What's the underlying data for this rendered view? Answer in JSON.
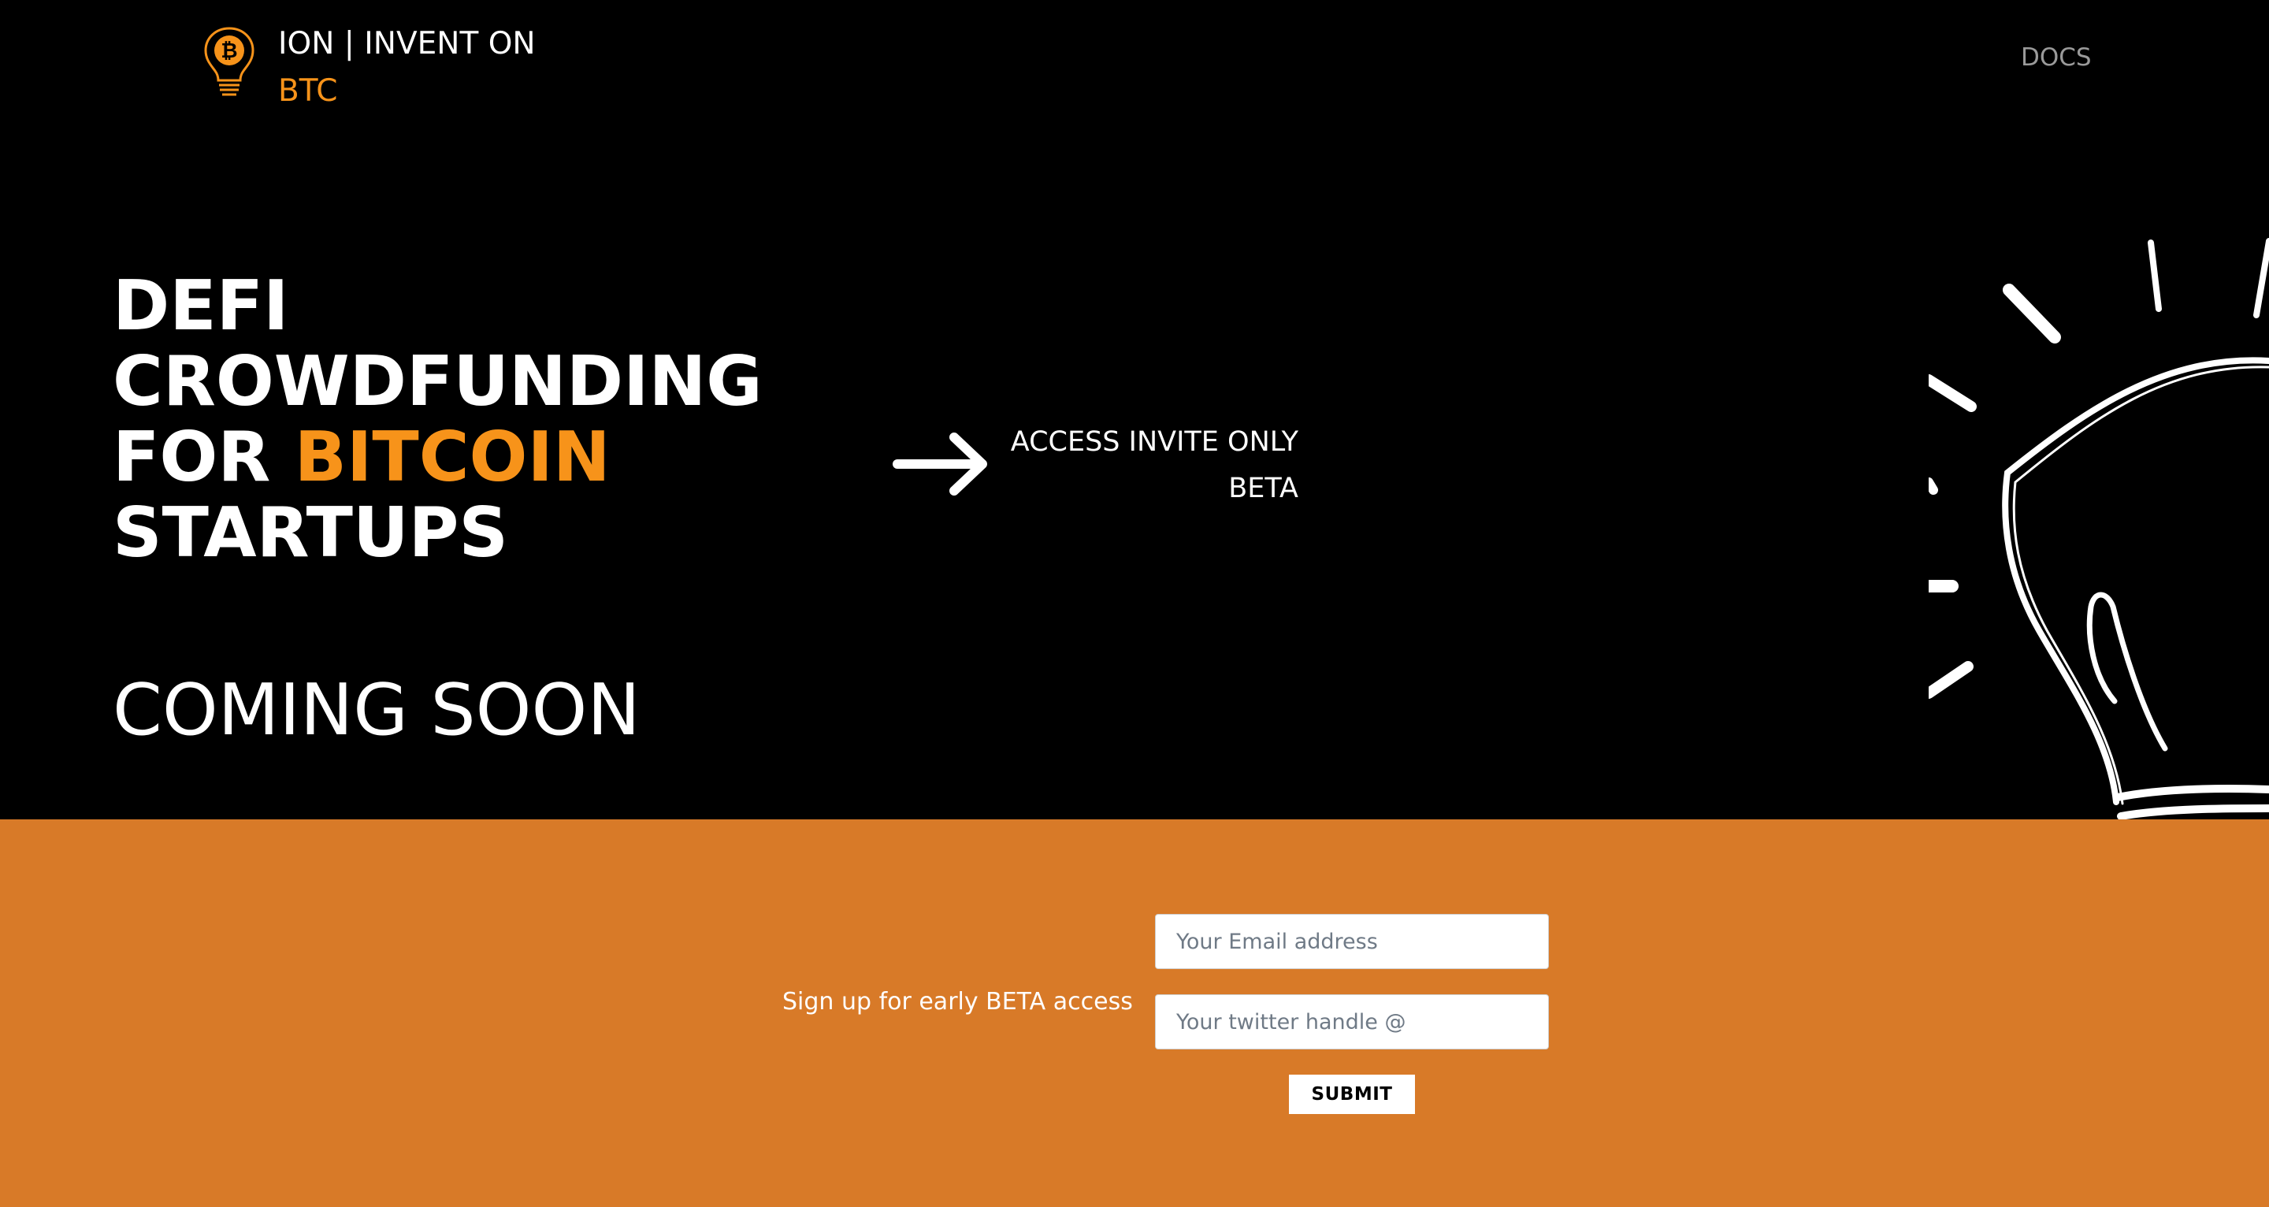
{
  "brand": {
    "name_line1": "ION | INVENT ON",
    "name_line2": "BTC",
    "accent_color": "#f7931a",
    "logo_icon": "bitcoin-lightbulb-icon"
  },
  "nav": {
    "docs_label": "DOCS"
  },
  "hero": {
    "headline_line1": "DEFI",
    "headline_line2": "CROWDFUNDING",
    "headline_line3_prefix": "FOR ",
    "headline_line3_accent": "BITCOIN",
    "headline_line4": "STARTUPS",
    "coming_soon": "COMING SOON",
    "access_line1": "ACCESS INVITE ONLY",
    "access_line2": "BETA",
    "arrow_icon": "arrow-right-icon",
    "art_icon": "lightbulb-illustration"
  },
  "signup": {
    "background_color": "#d87a28",
    "label": "Sign up for early BETA access",
    "email_placeholder": "Your Email address",
    "twitter_placeholder": "Your twitter handle @",
    "submit_label": "SUBMIT"
  }
}
